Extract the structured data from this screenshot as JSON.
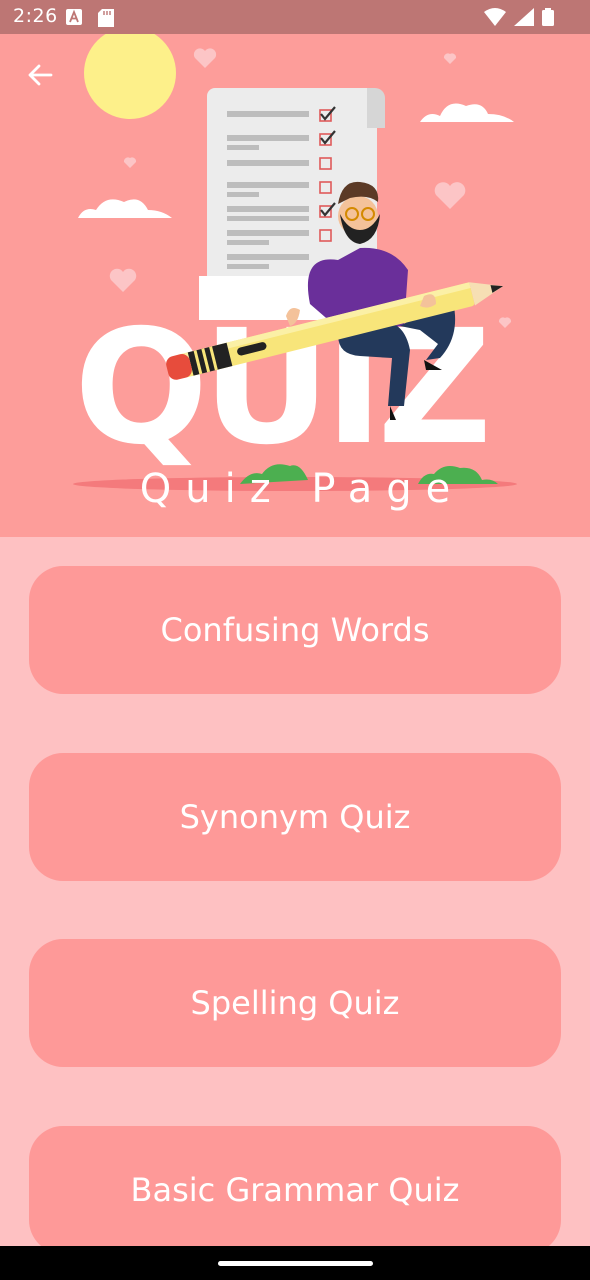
{
  "status_bar": {
    "time": "2:26",
    "icons": [
      "font-download-icon",
      "sd-card-icon",
      "wifi-icon",
      "signal-icon",
      "battery-icon"
    ]
  },
  "header": {
    "back_icon": "arrow-left-icon",
    "illustration_text": "QUIZ",
    "title": "Quiz Page"
  },
  "quiz_list": {
    "items": [
      {
        "label": "Confusing Words"
      },
      {
        "label": "Synonym Quiz"
      },
      {
        "label": "Spelling Quiz"
      },
      {
        "label": "Basic Grammar Quiz"
      }
    ]
  },
  "colors": {
    "status_bar": "#bd7674",
    "hero_background": "#fd9d9a",
    "page_background": "#fec1c2",
    "button_background": "#fe9998",
    "text": "#ffffff"
  }
}
